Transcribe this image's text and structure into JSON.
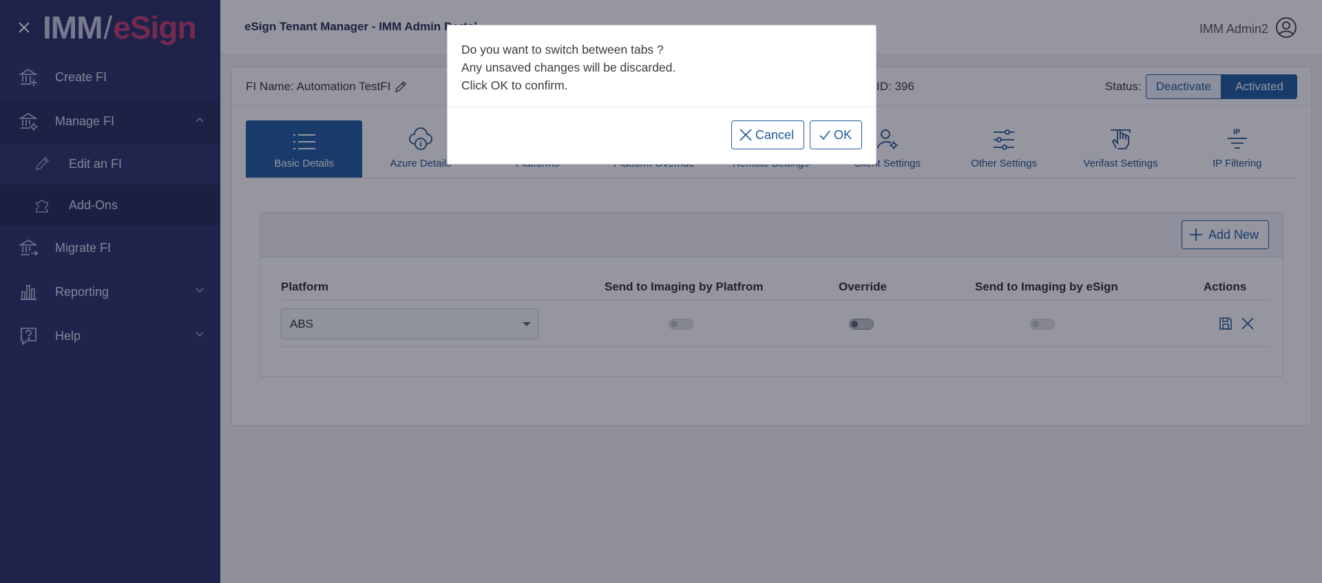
{
  "brand": {
    "part1": "IMM",
    "slash": "/",
    "part2": "eSign",
    "accent": "#c43b6d",
    "sidebar_bg": "#2a2f66",
    "primary": "#1d5a9d"
  },
  "sidebar": {
    "items": [
      {
        "label": "Create FI",
        "icon": "bank-plus-icon"
      },
      {
        "label": "Manage FI",
        "icon": "bank-gear-icon"
      },
      {
        "label": "Migrate FI",
        "icon": "bank-arrow-icon"
      },
      {
        "label": "Reporting",
        "icon": "bar-chart-icon"
      },
      {
        "label": "Help",
        "icon": "help-icon"
      }
    ],
    "sub_items": [
      {
        "label": "Edit an FI",
        "icon": "pencil-icon"
      },
      {
        "label": "Add-Ons",
        "icon": "puzzle-icon"
      }
    ]
  },
  "header": {
    "title": "eSign Tenant Manager - IMM Admin Portal",
    "user_name": "IMM Admin2"
  },
  "fi": {
    "name_label": "FI Name: Automation TestFI",
    "id_label": "ID: 396",
    "status_label": "Status:",
    "deactivate": "Deactivate",
    "activated": "Activated"
  },
  "tabs": [
    {
      "label": "Basic Details",
      "icon": "list-icon"
    },
    {
      "label": "Azure Details",
      "icon": "cloud-info-icon"
    },
    {
      "label": "Platforms",
      "icon": "platforms-icon"
    },
    {
      "label": "Platform Override",
      "icon": "override-icon"
    },
    {
      "label": "Remote Settings",
      "icon": "remote-icon"
    },
    {
      "label": "Client Settings",
      "icon": "user-gear-icon"
    },
    {
      "label": "Other Settings",
      "icon": "sliders-icon"
    },
    {
      "label": "Verifast Settings",
      "icon": "hand-icon"
    },
    {
      "label": "IP Filtering",
      "icon": "ip-filter-icon"
    }
  ],
  "panel": {
    "add_new": "Add New",
    "columns": [
      "Platform",
      "Send to Imaging by Platfrom",
      "Override",
      "Send to Imaging by eSign",
      "Actions"
    ],
    "row": {
      "platform": "ABS",
      "send_by_platform": false,
      "override": false,
      "send_by_esign": false
    }
  },
  "modal": {
    "line1": "Do you want to switch between tabs ?",
    "line2": "Any unsaved changes will be discarded.",
    "line3": "Click OK to confirm.",
    "cancel": "Cancel",
    "ok": "OK"
  }
}
